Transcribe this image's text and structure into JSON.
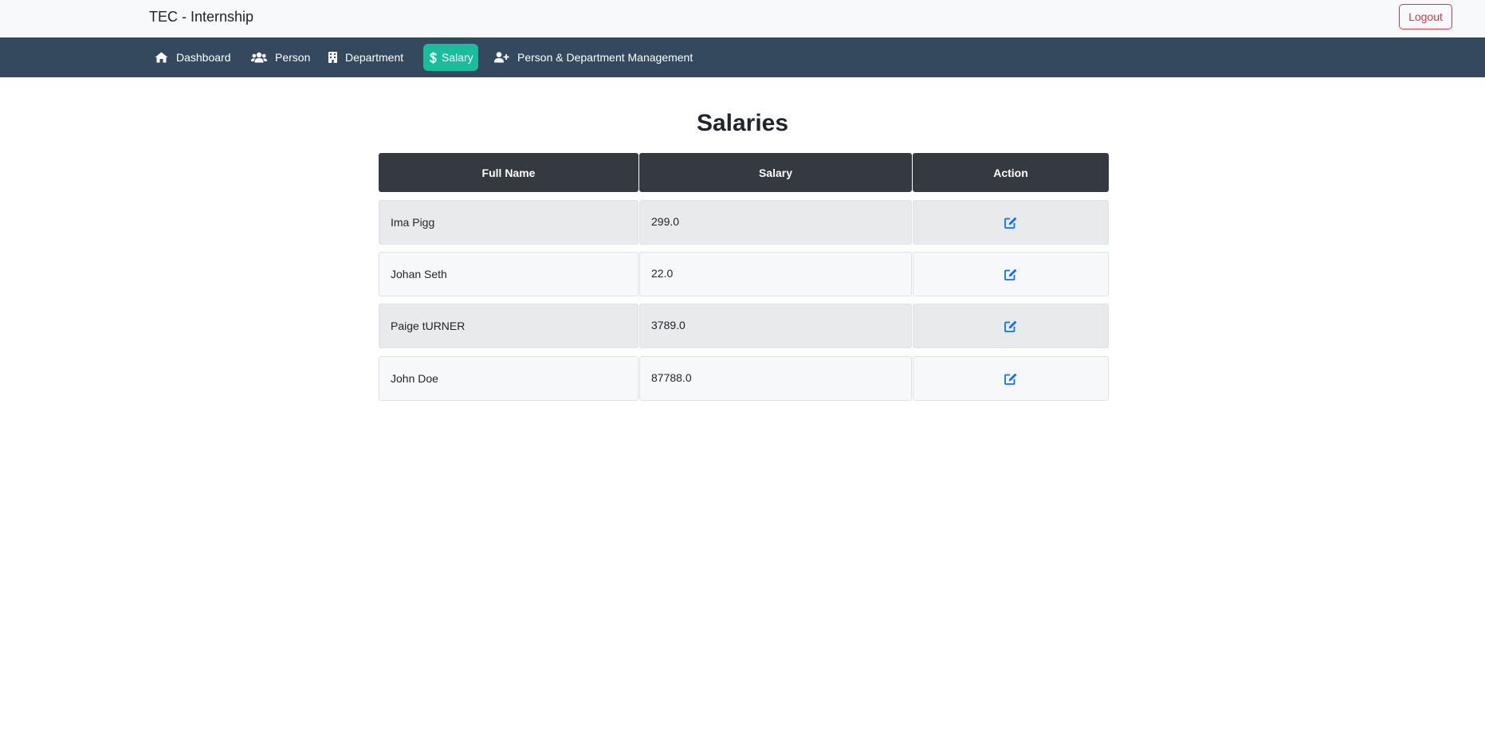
{
  "app": {
    "brand": "TEC - Internship",
    "logout_label": "Logout"
  },
  "nav": {
    "items": [
      {
        "label": "Dashboard",
        "icon": "home-icon"
      },
      {
        "label": "Person",
        "icon": "users-icon"
      },
      {
        "label": "Department",
        "icon": "building-icon"
      },
      {
        "label": "Salary",
        "icon": "dollar-icon",
        "active": true
      },
      {
        "label": "Person & Department Management",
        "icon": "user-plus-icon"
      }
    ]
  },
  "page": {
    "title": "Salaries"
  },
  "table": {
    "headers": [
      "Full Name",
      "Salary",
      "Action"
    ],
    "rows": [
      {
        "name": "Ima Pigg",
        "salary": "299.0"
      },
      {
        "name": "Johan Seth",
        "salary": "22.0"
      },
      {
        "name": "Paige tURNER",
        "salary": "3789.0"
      },
      {
        "name": "John Doe",
        "salary": "87788.0"
      }
    ],
    "action_icon": "edit-icon"
  },
  "colors": {
    "navbar": "#34495e",
    "active_nav": "#1abc9c",
    "header_cell": "#343a40",
    "logout": "#dc3545",
    "edit_icon": "#0d6efd"
  }
}
